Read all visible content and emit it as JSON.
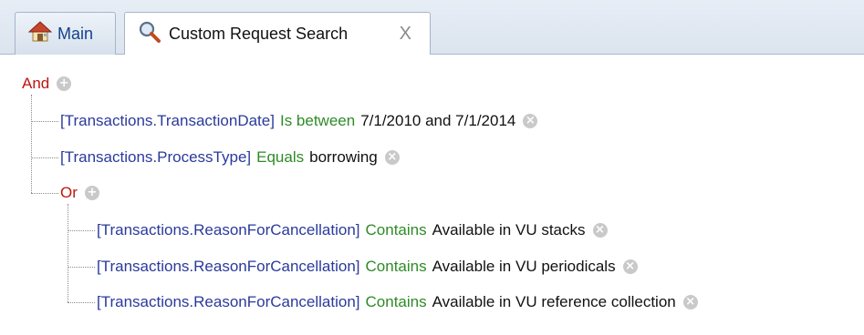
{
  "tabs": [
    {
      "label": "Main",
      "icon": "home-icon"
    },
    {
      "label": "Custom Request Search",
      "icon": "magnifier-icon",
      "close": "X"
    }
  ],
  "tree": {
    "root": {
      "operator": "And",
      "button": "+"
    },
    "conditions": [
      {
        "field": "[Transactions.TransactionDate]",
        "condition": "Is between",
        "value": "7/1/2010 and 7/1/2014",
        "button": "×"
      },
      {
        "field": "[Transactions.ProcessType]",
        "condition": "Equals",
        "value": "borrowing",
        "button": "×"
      }
    ],
    "group": {
      "operator": "Or",
      "button": "+",
      "conditions": [
        {
          "field": "[Transactions.ReasonForCancellation]",
          "condition": "Contains",
          "value": "Available in VU stacks",
          "button": "×"
        },
        {
          "field": "[Transactions.ReasonForCancellation]",
          "condition": "Contains",
          "value": "Available in VU periodicals",
          "button": "×"
        },
        {
          "field": "[Transactions.ReasonForCancellation]",
          "condition": "Contains",
          "value": "Available in VU reference collection",
          "button": "×"
        }
      ]
    }
  },
  "colors": {
    "operator": "#c0140f",
    "field": "#2a3a9c",
    "condition": "#2e8b26",
    "tab_text": "#15428b"
  }
}
